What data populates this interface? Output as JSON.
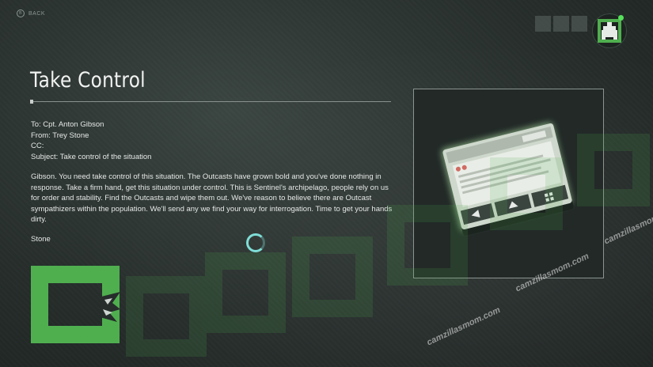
{
  "nav": {
    "back_label": "BACK",
    "back_glyph": "B"
  },
  "document": {
    "title": "Take Control",
    "to": "To: Cpt. Anton Gibson",
    "from": "From: Trey Stone",
    "cc": "CC:",
    "subject": "Subject: Take control of the situation",
    "body": "Gibson. You need take control of this situation. The Outcasts have grown bold and you've done nothing in response. Take a firm hand, get this situation under control. This is Sentinel's archipelago, people rely on us for order and stability. Find the Outcasts and wipe them out. We've reason to believe there are Outcast sympathizers within the population. We'll send any we find your way for interrogation. Time to get your hands dirty.",
    "signature": "Stone"
  },
  "watermark": {
    "text": "camzillasmom.com"
  },
  "colors": {
    "accent_green": "#4faf4f",
    "status_green": "#56e05a",
    "loader_cyan": "#7fded6"
  },
  "icons": {
    "loader": "loading-spinner-icon",
    "emblem": "faction-emblem-icon",
    "logo": "faction-logo-icon",
    "document_item": "phone-device-icon"
  }
}
